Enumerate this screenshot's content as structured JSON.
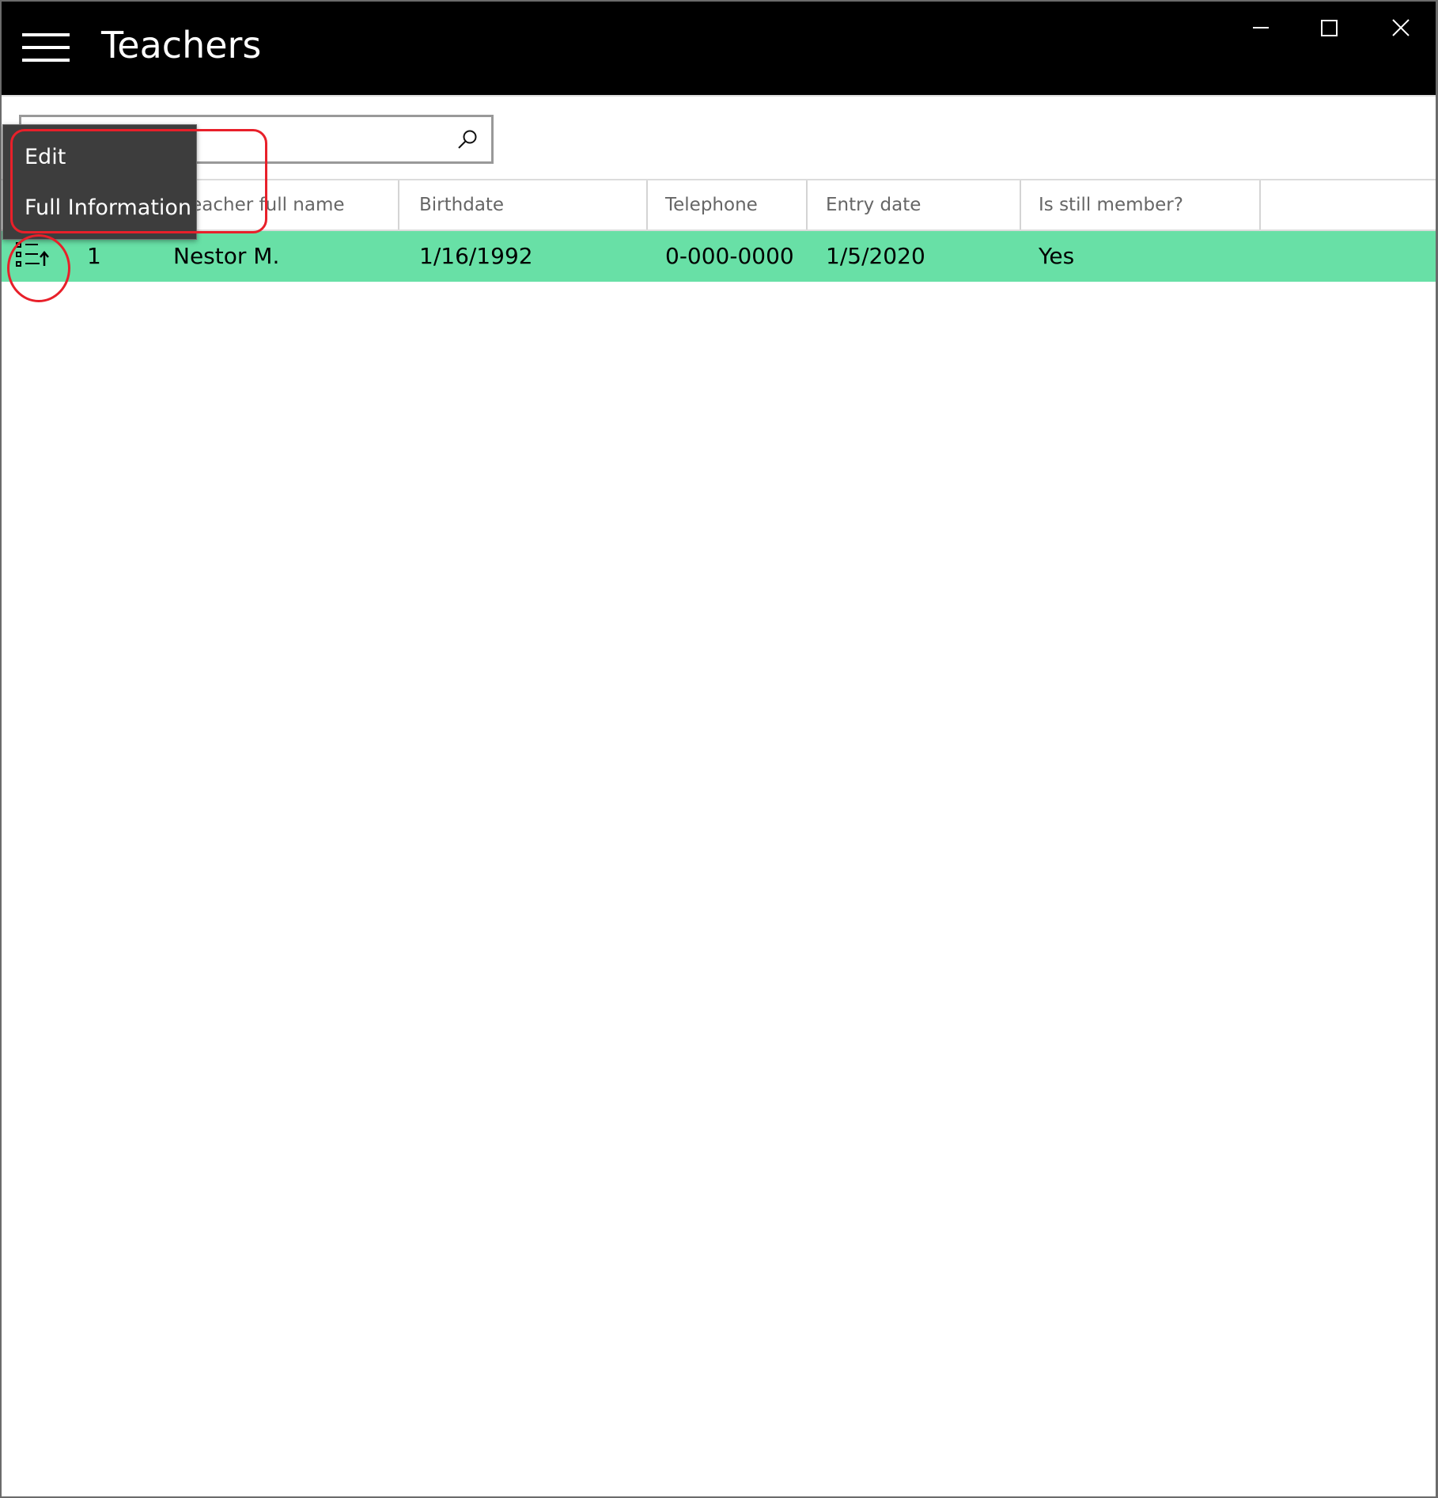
{
  "window": {
    "title": "Teachers",
    "controls": [
      "minimize",
      "maximize",
      "close"
    ]
  },
  "search": {
    "value": "",
    "placeholder": "",
    "icon": "search-icon"
  },
  "table": {
    "columns": [
      "",
      "",
      "Teacher full name",
      "Birthdate",
      "Telephone",
      "Entry date",
      "Is still member?"
    ],
    "visible_header_fragment": "cher ful  name",
    "rows": [
      {
        "row_menu_icon": "list-sort-icon",
        "index": "1",
        "name": "Nestor M.",
        "birthdate": "1/16/1992",
        "telephone": "0-000-0000",
        "entry_date": "1/5/2020",
        "is_member": "Yes",
        "selected": true
      }
    ]
  },
  "context_menu": {
    "items": [
      {
        "label": "Edit"
      },
      {
        "label": "Full Information"
      }
    ]
  },
  "colors": {
    "titlebar": "#000000",
    "selected_row": "#68e0a6",
    "flyout": "#3d3d3d",
    "annotation": "#e8202a"
  }
}
